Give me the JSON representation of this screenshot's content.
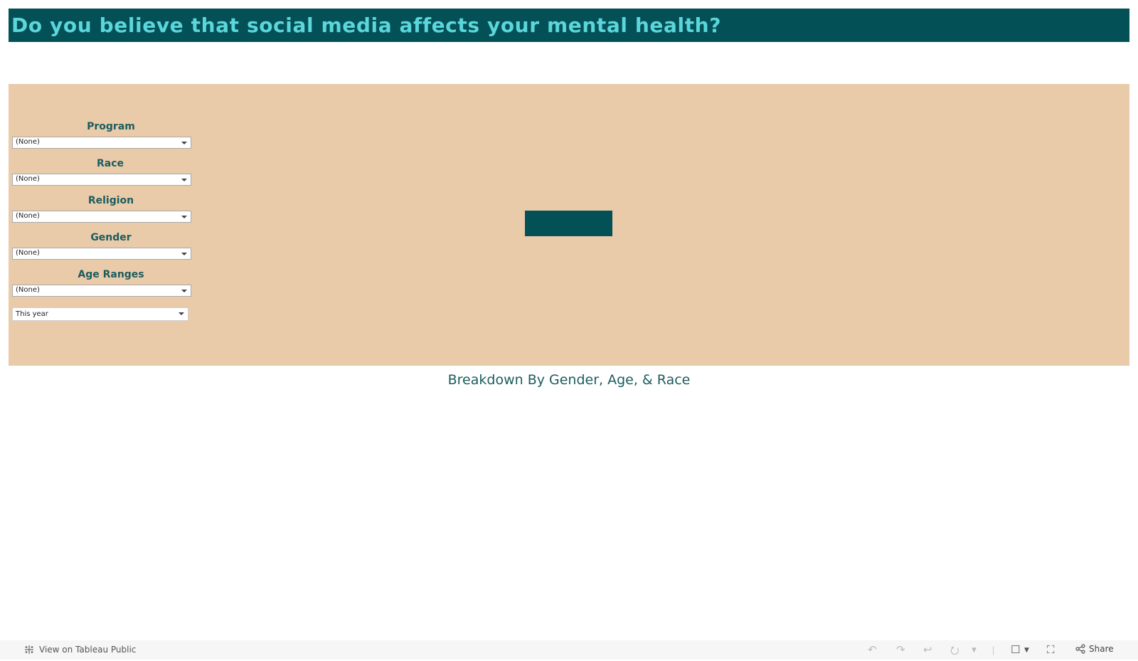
{
  "header": {
    "title": "Do you believe that social media affects your mental health?"
  },
  "filters": [
    {
      "label": "Program",
      "value": "(None)"
    },
    {
      "label": "Race",
      "value": "(None)"
    },
    {
      "label": "Religion",
      "value": "(None)"
    },
    {
      "label": "Gender",
      "value": "(None)"
    },
    {
      "label": "Age Ranges",
      "value": "(None)"
    }
  ],
  "date_filter": {
    "value": "This year"
  },
  "section": {
    "breakdown_title": "Breakdown By Gender, Age, & Race"
  },
  "colors": {
    "title_bg": "#045057",
    "title_text": "#5bd6da",
    "panel_bg": "#e9cbaa",
    "label_text": "#1d5c5e"
  },
  "footer": {
    "view_on_tableau": "View on Tableau Public",
    "share_label": "Share",
    "icons": [
      "undo-icon",
      "redo-icon",
      "revert-icon",
      "refresh-icon",
      "dropdown-icon",
      "download-icon",
      "fullscreen-icon",
      "share-icon"
    ]
  }
}
